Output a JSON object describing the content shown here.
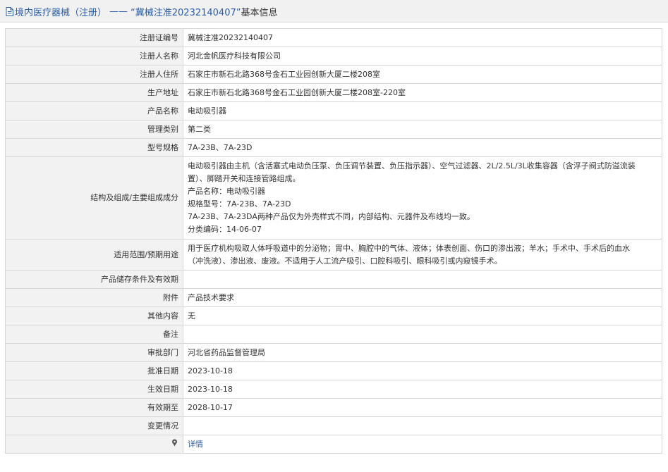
{
  "header": {
    "breadcrumb_db": "境内医疗器械（注册）",
    "separator": "——",
    "reg_no_quoted": "“冀械注准20232140407”",
    "suffix": "基本信息"
  },
  "rows": {
    "reg_no": {
      "label": "注册证编号",
      "value": "冀械注准20232140407"
    },
    "registrant": {
      "label": "注册人名称",
      "value": "河北金帆医疗科技有限公司"
    },
    "residence": {
      "label": "注册人住所",
      "value": "石家庄市新石北路368号金石工业园创新大厦二楼208室"
    },
    "production_address": {
      "label": "生产地址",
      "value": "石家庄市新石北路368号金石工业园创新大厦二楼208室-220室"
    },
    "product_name": {
      "label": "产品名称",
      "value": "电动吸引器"
    },
    "category": {
      "label": "管理类别",
      "value": "第二类"
    },
    "model": {
      "label": "型号规格",
      "value": "7A-23B、7A-23D"
    },
    "composition": {
      "label": "结构及组成/主要组成成分",
      "lines": [
        "电动吸引器由主机（含活塞式电动负压泵、负压调节装置、负压指示器）、空气过滤器、2L/2.5L/3L收集容器（含浮子阀式防溢流装",
        "置）、脚踏开关和连接管路组成。",
        "产品名称：电动吸引器",
        "规格型号：7A-23B、7A-23D",
        "7A-23B、7A-23DA两种产品仅为外壳样式不同，内部结构、元器件及布线均一致。",
        "分类编码：14-06-07"
      ]
    },
    "scope": {
      "label": "适用范围/预期用途",
      "lines": [
        "用于医疗机构吸取人体呼吸道中的分泌物；胃中、胸腔中的气体、液体；体表创面、伤口的渗出液；羊水；手术中、手术后的血水",
        "（冲洗液）、渗出液、废液。不适用于人工流产吸引、口腔科吸引、眼科吸引或内窥镜手术。"
      ]
    },
    "storage": {
      "label": "产品储存条件及有效期",
      "value": ""
    },
    "attachment": {
      "label": "附件",
      "value": "产品技术要求"
    },
    "other": {
      "label": "其他内容",
      "value": "无"
    },
    "remark": {
      "label": "备注",
      "value": ""
    },
    "approval_dept": {
      "label": "审批部门",
      "value": "河北省药品监督管理局"
    },
    "approval_date": {
      "label": "批准日期",
      "value": "2023-10-18"
    },
    "effective_date": {
      "label": "生效日期",
      "value": "2023-10-18"
    },
    "valid_until": {
      "label": "有效期至",
      "value": "2028-10-17"
    },
    "changes": {
      "label": "变更情况",
      "value": ""
    },
    "note": {
      "label": "",
      "link": "详情"
    }
  },
  "colors": {
    "link": "#2a5daa",
    "label_bg": "#f2f2f2",
    "header_bg": "#f1f1f1",
    "border": "#d6d6d6"
  },
  "icons": {
    "header": "document-icon",
    "note": "pin-icon"
  }
}
